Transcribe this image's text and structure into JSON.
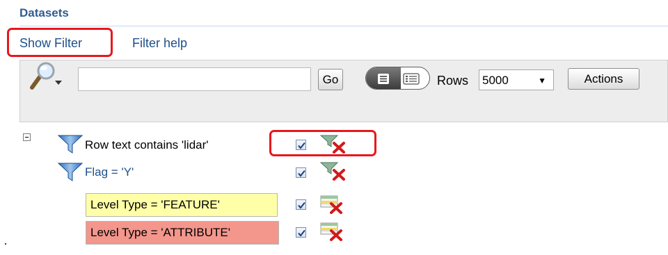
{
  "section": {
    "title": "Datasets"
  },
  "links": {
    "show_filter": "Show Filter",
    "filter_help": "Filter help"
  },
  "toolbar": {
    "search_value": "",
    "go_label": "Go",
    "rows_label": "Rows",
    "rows_value": "5000",
    "actions_label": "Actions",
    "icons": [
      "search-magnifier-icon",
      "view-toggle-icon"
    ]
  },
  "filters": [
    {
      "label": "Row text contains 'lidar'",
      "enabled": true,
      "icon": "funnel-icon",
      "remove_icon": "remove-filter-icon"
    },
    {
      "label": "Flag = 'Y'",
      "enabled": true,
      "icon": "funnel-icon",
      "remove_icon": "remove-filter-icon"
    },
    {
      "label": "Level Type = 'FEATURE'",
      "enabled": true,
      "highlight_color": "#ffffa8",
      "remove_icon": "remove-highlight-icon"
    },
    {
      "label": "Level Type = 'ATTRIBUTE'",
      "enabled": true,
      "highlight_color": "#f3968c",
      "remove_icon": "remove-highlight-icon"
    }
  ],
  "colors": {
    "accent": "#2f5d92",
    "link": "#1f4f8a",
    "annotation": "#e8171b"
  }
}
